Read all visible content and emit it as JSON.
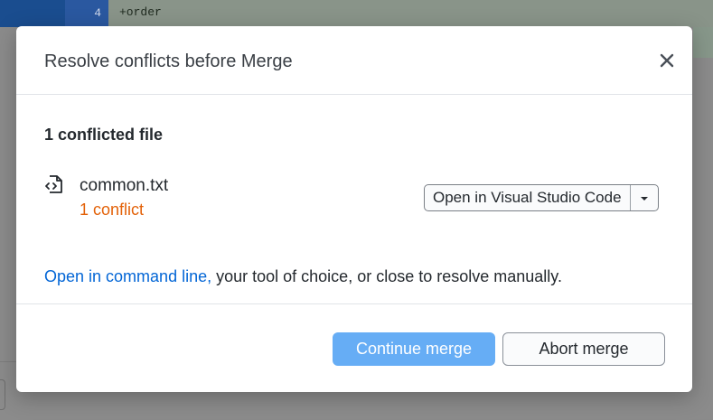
{
  "background": {
    "line_number": "4",
    "code_line": "+order"
  },
  "dialog": {
    "title": "Resolve conflicts before Merge",
    "close_icon": "close-icon",
    "conflict_heading": "1 conflicted file",
    "file": {
      "name": "common.txt",
      "conflicts": "1 conflict",
      "icon": "file-code-icon"
    },
    "open_editor_label": "Open in Visual Studio Code",
    "open_editor_caret_icon": "caret-down-icon",
    "resolve": {
      "link_text": "Open in command line,",
      "rest_text": " your tool of choice, or close to resolve manually."
    },
    "continue_label": "Continue merge",
    "abort_label": "Abort merge"
  },
  "colors": {
    "link": "#0366d6",
    "conflict": "#e36209",
    "primary_button_disabled": "#66adf5"
  }
}
